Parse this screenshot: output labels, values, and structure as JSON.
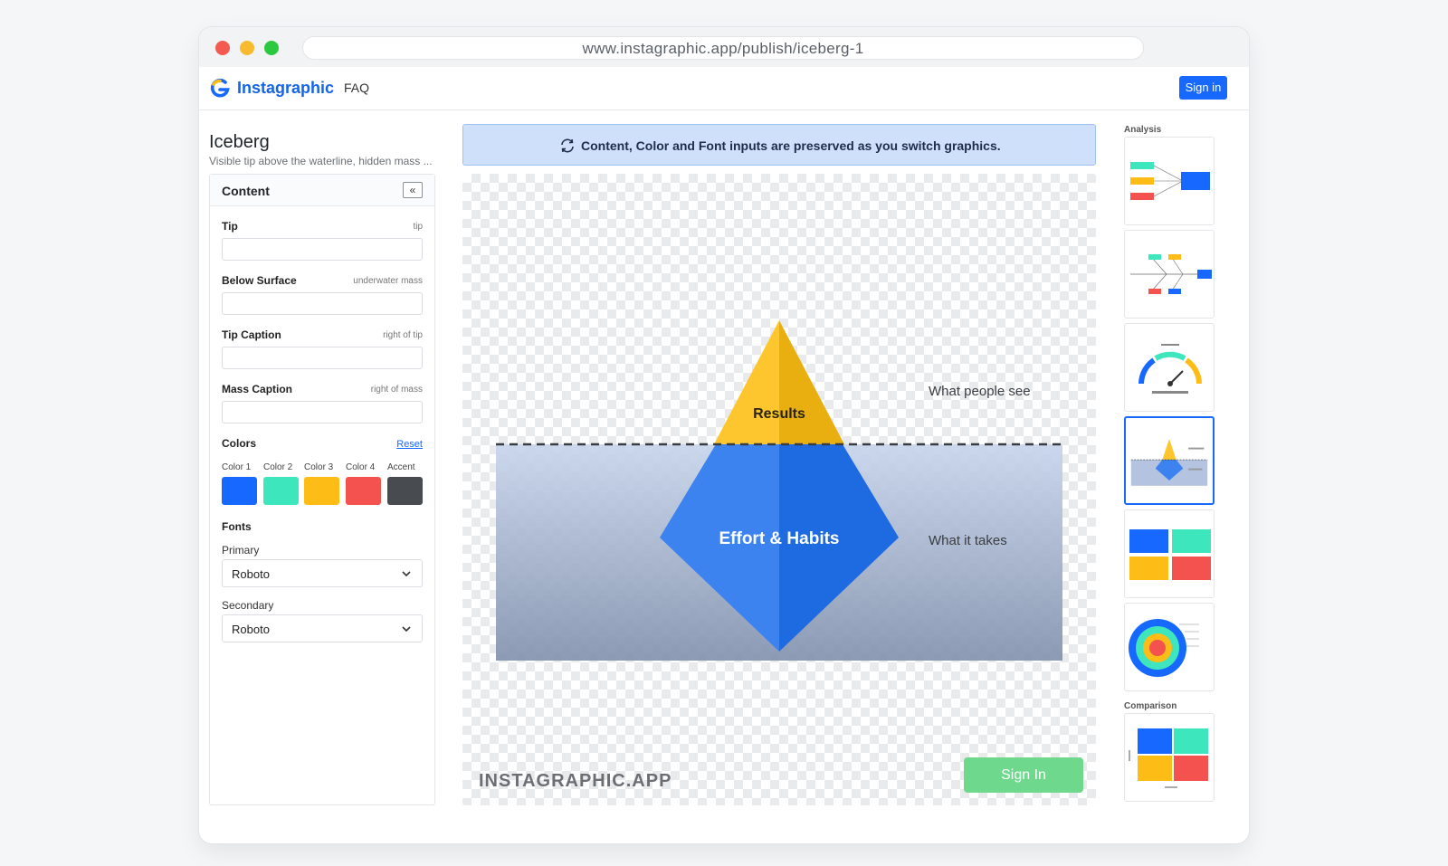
{
  "browser": {
    "url": "www.instagraphic.app/publish/iceberg-1"
  },
  "header": {
    "brand": "Instagraphic",
    "nav_faq": "FAQ",
    "signin_label": "Sign in"
  },
  "left_panel": {
    "title": "Iceberg",
    "subtitle": "Visible tip above the waterline, hidden mass ...",
    "section_title": "Content",
    "collapse_label": "«",
    "fields": [
      {
        "label": "Tip",
        "hint": "tip",
        "value": ""
      },
      {
        "label": "Below Surface",
        "hint": "underwater mass",
        "value": ""
      },
      {
        "label": "Tip Caption",
        "hint": "right of tip",
        "value": ""
      },
      {
        "label": "Mass Caption",
        "hint": "right of mass",
        "value": ""
      }
    ],
    "colors": {
      "label": "Colors",
      "reset_label": "Reset",
      "swatches": [
        {
          "label": "Color 1",
          "color": "#1668ff"
        },
        {
          "label": "Color 2",
          "color": "#3ee6bd"
        },
        {
          "label": "Color 3",
          "color": "#fdbd16"
        },
        {
          "label": "Color 4",
          "color": "#f4524e"
        },
        {
          "label": "Accent",
          "color": "#484c50"
        }
      ]
    },
    "fonts": {
      "label": "Fonts",
      "primary_label": "Primary",
      "primary_value": "Roboto",
      "secondary_label": "Secondary",
      "secondary_value": "Roboto"
    }
  },
  "notice": {
    "text": "Content, Color and Font inputs are preserved as you switch graphics."
  },
  "graphic": {
    "tip_text": "Results",
    "mass_text": "Effort & Habits",
    "tip_caption": "What people see",
    "mass_caption": "What it takes",
    "watermark": "INSTAGRAPHIC.APP",
    "signin_label": "Sign In",
    "colors": {
      "tip": "#fdc62e",
      "tip_shade": "#e9ae10",
      "mass": "#3d83f0",
      "mass_shade": "#1e6ae0",
      "water_top": "#c7d5ec",
      "water_bottom": "#8392ae"
    }
  },
  "right_panel": {
    "sections": [
      {
        "label": "Analysis"
      },
      {
        "label": "Comparison"
      }
    ],
    "thumbnails": [
      {
        "name": "flow-diagram"
      },
      {
        "name": "fishbone"
      },
      {
        "name": "gauge"
      },
      {
        "name": "iceberg",
        "active": true
      },
      {
        "name": "quadrant-grid"
      },
      {
        "name": "target-rings"
      },
      {
        "name": "comparison-matrix"
      }
    ]
  }
}
